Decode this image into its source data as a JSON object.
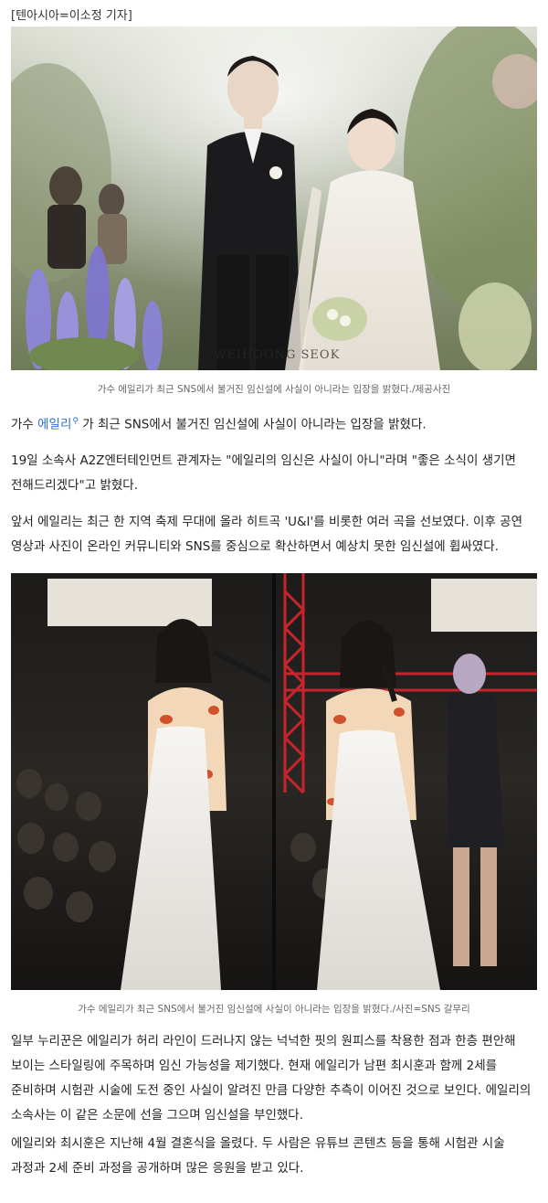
{
  "byline": "[텐아시아=이소정 기자]",
  "figure1": {
    "watermark": "WEIHOONG SEOK",
    "caption": "가수 에일리가 최근 SNS에서 불거진 임신설에 사실이 아니라는 입장을 밝혔다./제공사진"
  },
  "paragraph1": {
    "before": "가수 ",
    "link": "에일리",
    "link_icon": "search-icon",
    "after": " 가 최근 SNS에서 불거진 임신설에 사실이 아니라는 입장을 밝혔다."
  },
  "paragraph2": "19일 소속사 A2Z엔터테인먼트 관계자는 \"에일리의 임신은 사실이 아니\"라며 \"좋은 소식이 생기면 전해드리겠다\"고 밝혔다.",
  "paragraph3": "앞서 에일리는 최근 한 지역 축제 무대에 올라 히트곡 'U&I'를 비롯한 여러 곡을 선보였다. 이후 공연 영상과 사진이 온라인 커뮤니티와 SNS를 중심으로 확산하면서 예상치 못한 임신설에 휩싸였다.",
  "figure2": {
    "caption": "가수 에일리가 최근 SNS에서 불거진 임신설에 사실이 아니라는 입장을 밝혔다./사진=SNS 갈무리"
  },
  "paragraph4": "일부 누리꾼은 에일리가 허리 라인이 드러나지 않는 넉넉한 핏의 원피스를 착용한 점과 한층 편안해 보이는 스타일링에 주목하며 임신 가능성을 제기했다. 현재 에일리가 남편 최시훈과 함께 2세를 준비하며 시험관 시술에 도전 중인 사실이 알려진 만큼 다양한 추측이 이어진 것으로 보인다. 에일리의 소속사는 이 같은 소문에 선을 그으며 임신설을 부인했다.",
  "paragraph5": "에일리와 최시훈은 지난해 4월 결혼식을 올렸다. 두 사람은 유튜브 콘텐츠 등을 통해 시험관 시술 과정과 2세 준비 과정을 공개하며 많은 응원을 받고 있다.",
  "colors": {
    "link": "#2b6fd6",
    "caption": "#666666",
    "body_text": "#222222"
  }
}
